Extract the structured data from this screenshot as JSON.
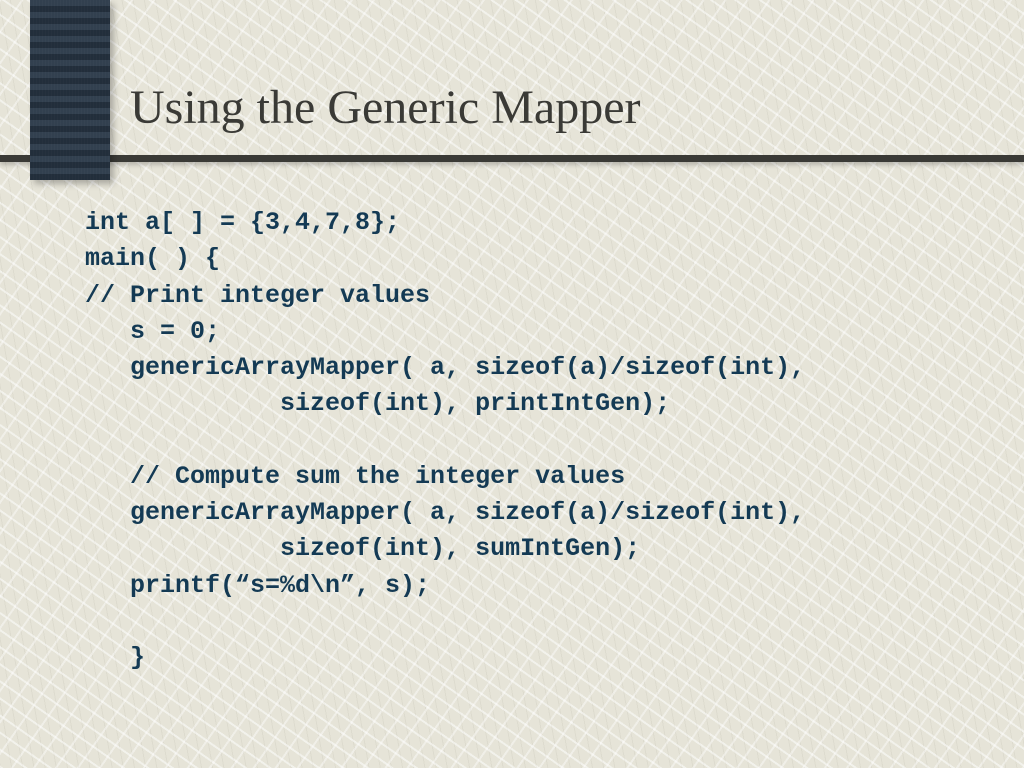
{
  "slide": {
    "title": "Using the Generic Mapper",
    "code_lines": [
      "int a[ ] = {3,4,7,8};",
      "main( ) {",
      "// Print integer values",
      "   s = 0;",
      "   genericArrayMapper( a, sizeof(a)/sizeof(int),",
      "             sizeof(int), printIntGen);",
      "",
      "   // Compute sum the integer values",
      "   genericArrayMapper( a, sizeof(a)/sizeof(int),",
      "             sizeof(int), sumIntGen);",
      "   printf(“s=%d\\n”, s);",
      "",
      "   }"
    ]
  }
}
